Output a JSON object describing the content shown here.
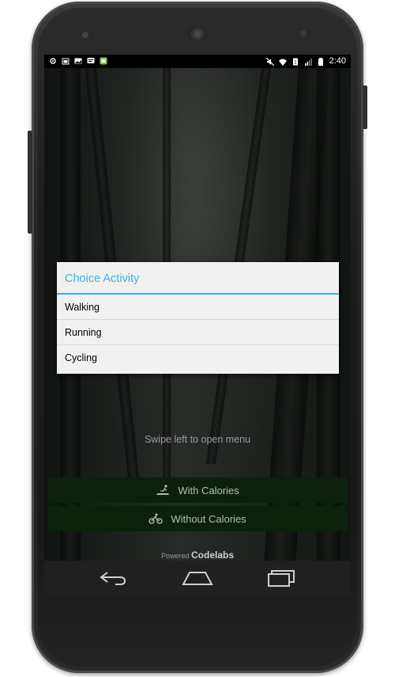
{
  "status_bar": {
    "time": "2:40"
  },
  "dialog": {
    "title": "Choice Activity",
    "items": [
      {
        "label": "Walking"
      },
      {
        "label": "Running"
      },
      {
        "label": "Cycling"
      }
    ]
  },
  "main": {
    "swipe_hint": "Swipe left to open menu",
    "with_calories_label": "With Calories",
    "without_calories_label": "Without Calories"
  },
  "footer": {
    "powered_label": "Powered",
    "brand": "Codelabs"
  },
  "colors": {
    "accent": "#33b5e5",
    "button_bg": "#0c200c"
  }
}
